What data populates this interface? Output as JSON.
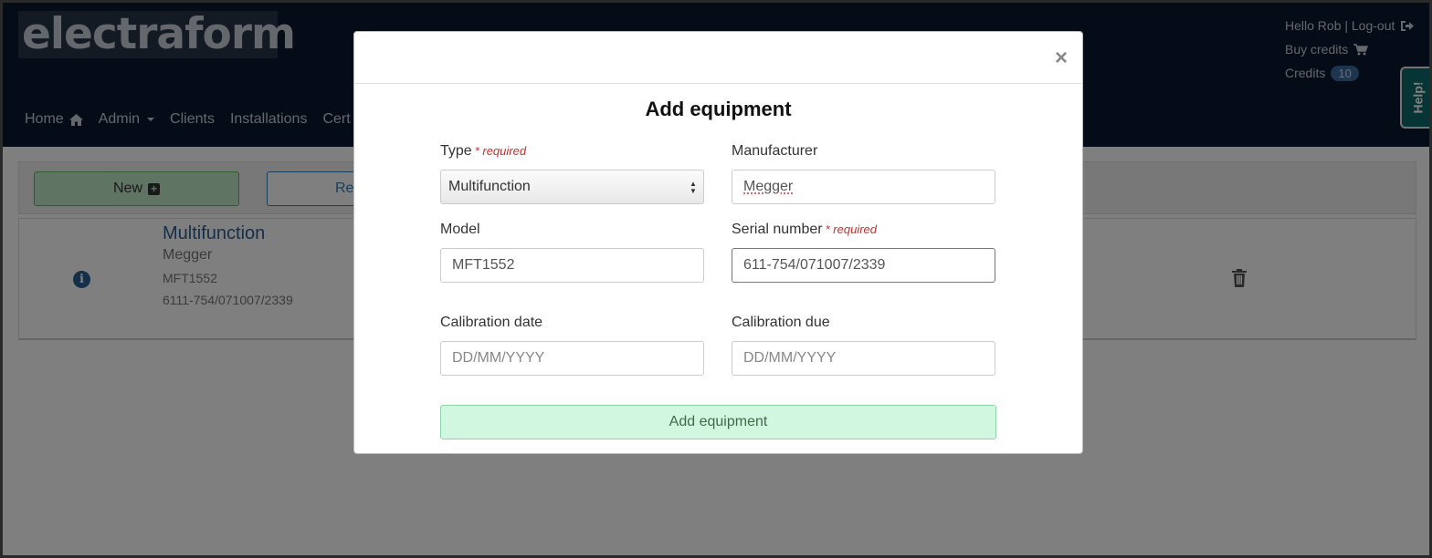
{
  "brand": "electraform",
  "nav": {
    "home": "Home",
    "admin": "Admin",
    "clients": "Clients",
    "installations": "Installations",
    "certs": "Cert"
  },
  "user": {
    "greeting": "Hello Rob | Log-out",
    "buy_credits": "Buy credits",
    "credits_label": "Credits",
    "credits_count": "10"
  },
  "help_tab": "Help!",
  "toolbar": {
    "new_label": "New",
    "ret_label": "Re"
  },
  "list": {
    "items": [
      {
        "type": "Multifunction",
        "manufacturer": "Megger",
        "model": "MFT1552",
        "serial": "6111-754/071007/2339"
      }
    ]
  },
  "modal": {
    "close": "×",
    "title": "Add equipment",
    "required_text": "* required",
    "type": {
      "label": "Type",
      "value": "Multifunction"
    },
    "manufacturer": {
      "label": "Manufacturer",
      "value": "Megger"
    },
    "model": {
      "label": "Model",
      "value": "MFT1552"
    },
    "serial": {
      "label": "Serial number",
      "value": "611-754/071007/2339"
    },
    "calibration_date": {
      "label": "Calibration date",
      "placeholder": "DD/MM/YYYY"
    },
    "calibration_due": {
      "label": "Calibration due",
      "placeholder": "DD/MM/YYYY"
    },
    "submit_label": "Add equipment"
  },
  "colors": {
    "navbar": "#0b1930",
    "brand_accent": "#2a5f96",
    "success_light": "#d2f7e0",
    "required": "#c9302c",
    "help_tab": "#0f6b6b"
  },
  "icons": {
    "home": "home-icon",
    "logout": "logout-icon",
    "cart": "cart-icon",
    "plus": "plus-square-icon",
    "info": "info-circle-icon",
    "trash": "trash-icon"
  }
}
